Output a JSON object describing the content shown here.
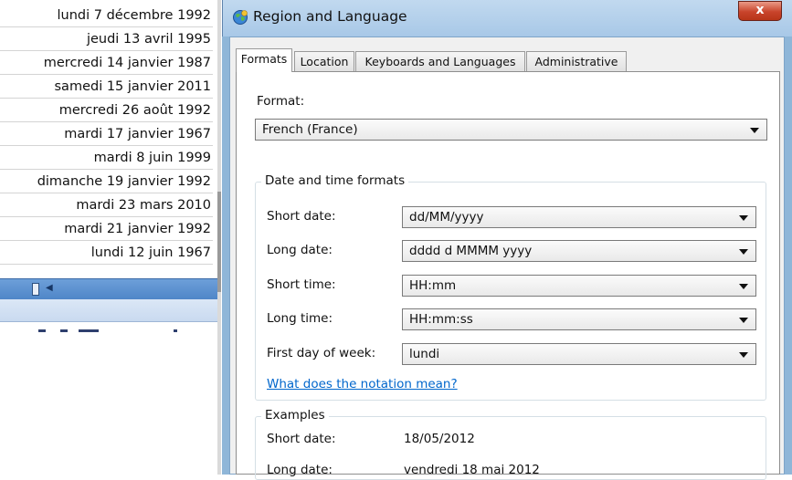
{
  "spreadsheet": {
    "dates": [
      "lundi 7 décembre 1992",
      "jeudi 13 avril 1995",
      "mercredi 14 janvier 1987",
      "samedi 15 janvier 2011",
      "mercredi 26 août 1992",
      "mardi 17 janvier 1967",
      "mardi 8 juin 1999",
      "dimanche 19 janvier 1992",
      "mardi 23 mars 2010",
      "mardi 21 janvier 1992",
      "lundi 12 juin 1967"
    ]
  },
  "dialog": {
    "title": "Region and Language",
    "close_label": "x",
    "tabs": [
      "Formats",
      "Location",
      "Keyboards and Languages",
      "Administrative"
    ],
    "active_tab": "Formats",
    "format_label": "Format:",
    "format_value": "French (France)",
    "datetime_group": {
      "title": "Date and time formats",
      "fields": [
        {
          "label": "Short date:",
          "value": "dd/MM/yyyy"
        },
        {
          "label": "Long date:",
          "value": "dddd d MMMM yyyy"
        },
        {
          "label": "Short time:",
          "value": "HH:mm"
        },
        {
          "label": "Long time:",
          "value": "HH:mm:ss"
        },
        {
          "label": "First day of week:",
          "value": "lundi"
        }
      ],
      "notation_link": "What does the notation mean?"
    },
    "examples_group": {
      "title": "Examples",
      "items": [
        {
          "label": "Short date:",
          "value": "18/05/2012"
        },
        {
          "label": "Long date:",
          "value": "vendredi 18 mai 2012"
        }
      ]
    }
  },
  "icons": {
    "title_icon": "globe-icon",
    "dropdown_icon": "chevron-down-icon"
  },
  "colors": {
    "titlebar": "#b5d0ec",
    "close_button": "#c8442b",
    "link": "#0066cc",
    "scrollbar": "#5b8fd0"
  }
}
